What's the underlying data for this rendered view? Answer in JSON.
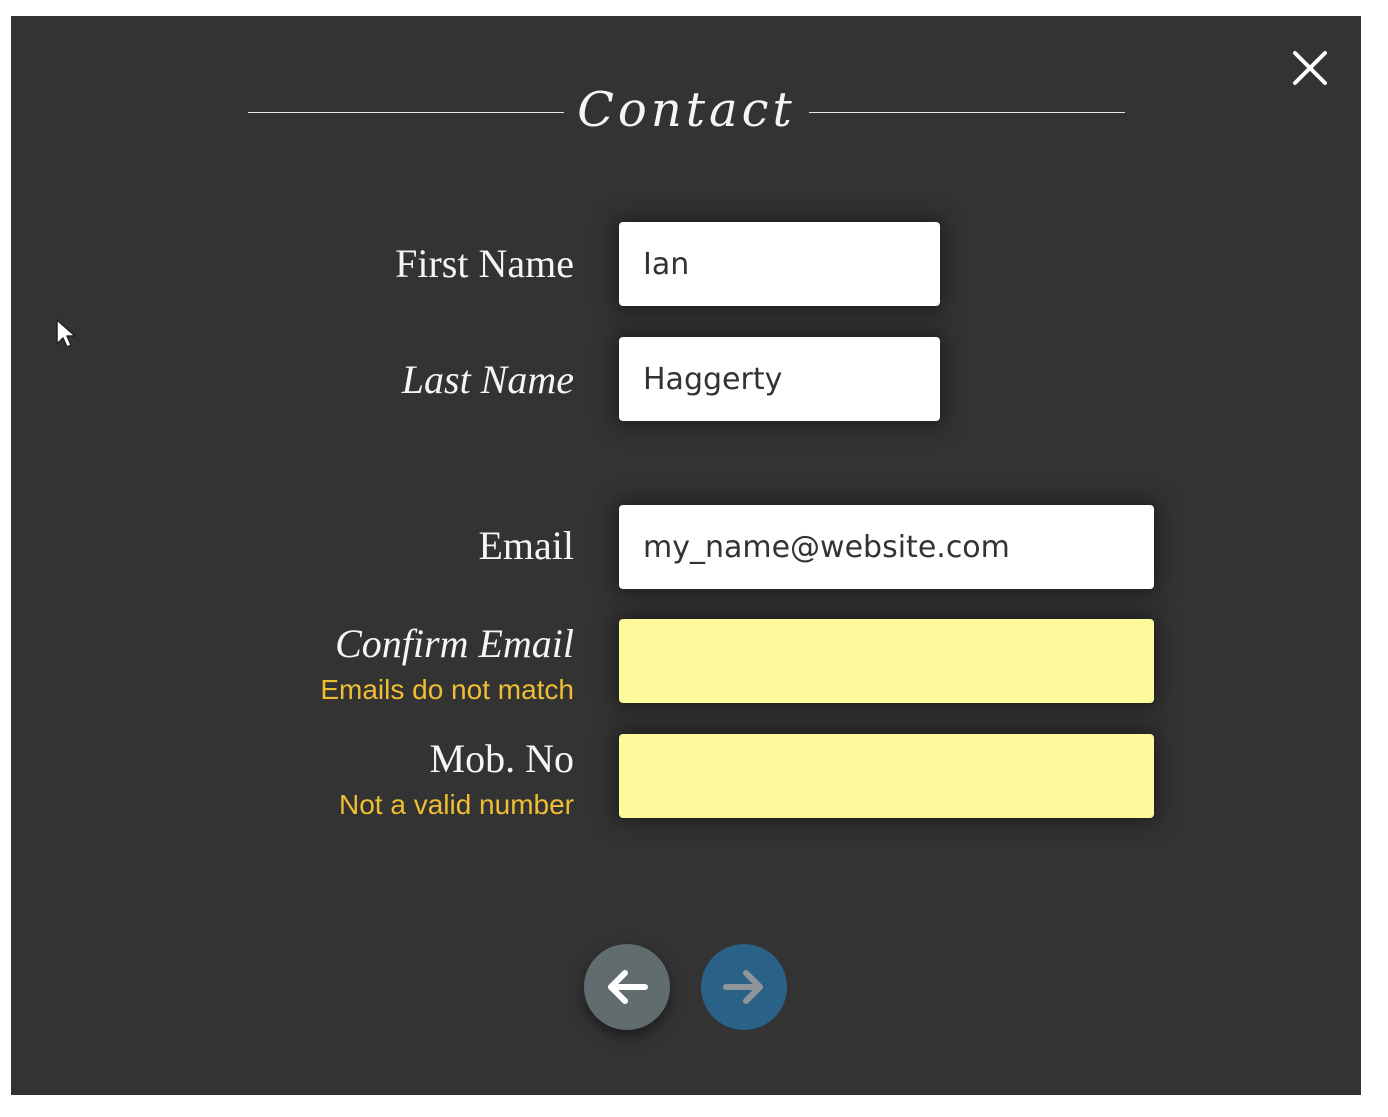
{
  "dialog": {
    "title": "Contact",
    "close_icon": "close-icon"
  },
  "form": {
    "first_name": {
      "label": "First Name",
      "value": "Ian"
    },
    "last_name": {
      "label": "Last Name",
      "value": "Haggerty"
    },
    "email": {
      "label": "Email",
      "value": "my_name@website.com"
    },
    "confirm_email": {
      "label": "Confirm Email",
      "value": "",
      "error": "Emails do not match"
    },
    "mobile": {
      "label": "Mob. No",
      "value": "",
      "error": "Not a valid number"
    }
  },
  "navigation": {
    "prev_icon": "arrow-left-icon",
    "next_icon": "arrow-right-icon"
  },
  "colors": {
    "modal_background": "#333333",
    "error_text": "#f0be32",
    "invalid_field": "#fef99b",
    "prev_button": "#616c6f",
    "next_button": "#2a6287"
  }
}
